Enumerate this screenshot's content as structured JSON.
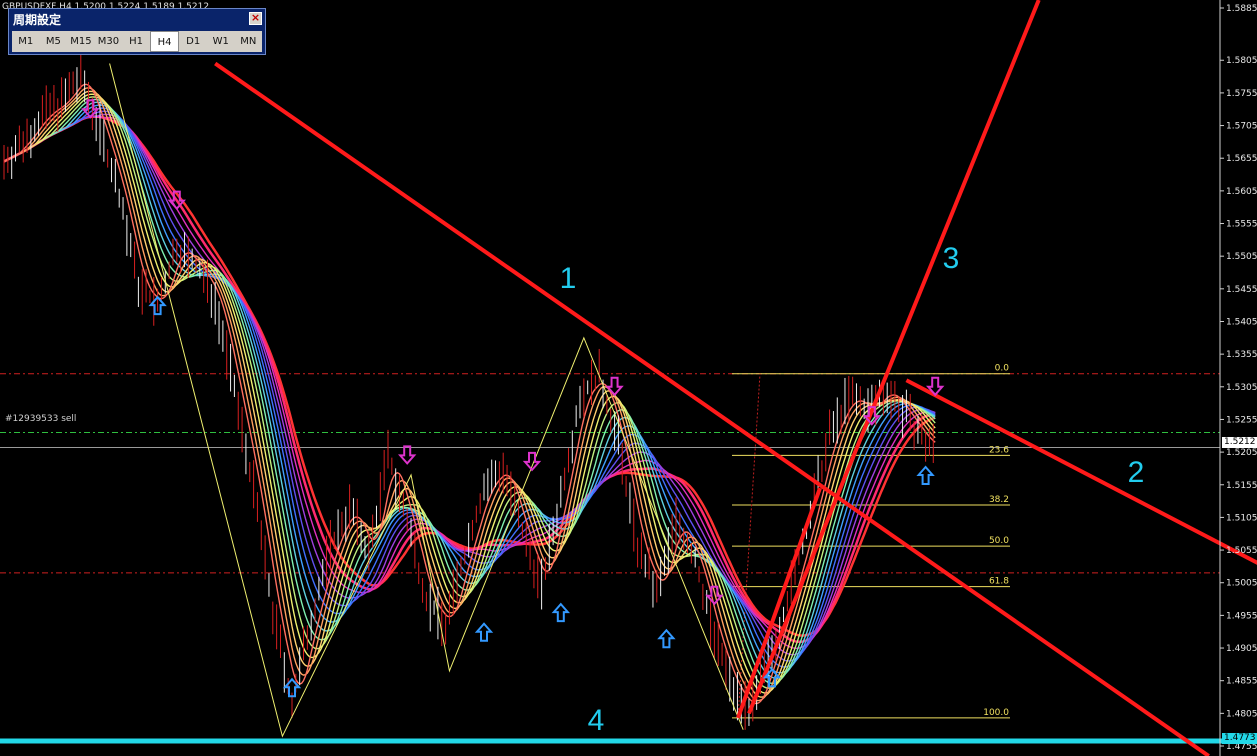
{
  "header": {
    "symbol_line": "GBPUSDFXF,H4  1.5200 1.5224 1.5189 1.5212"
  },
  "timeframe_panel": {
    "title": "周期設定",
    "buttons": [
      "M1",
      "M5",
      "M15",
      "M30",
      "H1",
      "H4",
      "D1",
      "W1",
      "MN"
    ],
    "active": "H4"
  },
  "order_label": "#12939533 sell",
  "wave_labels": [
    "1",
    "2",
    "3",
    "4"
  ],
  "colors": {
    "background": "#000000",
    "trendline": "#ff1a1a",
    "candle": "#d92020",
    "fib": "#f0e060",
    "support": "#22d8e8",
    "buy_arrow": "#3399ff",
    "sell_arrow": "#dd33cc"
  },
  "chart_data": {
    "type": "line",
    "title": "GBPUSDFXF,H4",
    "y_axis": {
      "range": [
        1.4755,
        1.5885
      ],
      "tick_labels": [
        "1.5885",
        "1.5805",
        "1.5755",
        "1.5705",
        "1.5655",
        "1.5605",
        "1.5555",
        "1.5505",
        "1.5455",
        "1.5405",
        "1.5355",
        "1.5305",
        "1.5255",
        "1.5205",
        "1.5155",
        "1.5105",
        "1.5055",
        "1.5005",
        "1.4955",
        "1.4905",
        "1.4855",
        "1.4805",
        "1.4755"
      ]
    },
    "current_price": "1.5212",
    "support_price": "1.4773",
    "order_price": 1.5235,
    "fibonacci": {
      "high": 1.5325,
      "low": 1.4798,
      "levels": [
        {
          "label": "0.0",
          "value": 1.5325
        },
        {
          "label": "23.6",
          "value": 1.52
        },
        {
          "label": "38.2",
          "value": 1.5124
        },
        {
          "label": "50.0",
          "value": 1.5061
        },
        {
          "label": "61.8",
          "value": 1.4999
        },
        {
          "label": "100.0",
          "value": 1.4798
        }
      ]
    },
    "horizontal_levels": [
      {
        "name": "resistance",
        "value": 1.5325
      },
      {
        "name": "order",
        "value": 1.5235
      },
      {
        "name": "support-dash",
        "value": 1.502
      }
    ],
    "price_path": [
      {
        "bar": 0,
        "price": 1.565
      },
      {
        "bar": 10,
        "price": 1.568
      },
      {
        "bar": 20,
        "price": 1.572
      },
      {
        "bar": 30,
        "price": 1.574
      },
      {
        "bar": 40,
        "price": 1.578
      },
      {
        "bar": 50,
        "price": 1.57
      },
      {
        "bar": 60,
        "price": 1.56
      },
      {
        "bar": 70,
        "price": 1.546
      },
      {
        "bar": 80,
        "price": 1.543
      },
      {
        "bar": 90,
        "price": 1.552
      },
      {
        "bar": 100,
        "price": 1.549
      },
      {
        "bar": 110,
        "price": 1.544
      },
      {
        "bar": 120,
        "price": 1.53
      },
      {
        "bar": 130,
        "price": 1.515
      },
      {
        "bar": 140,
        "price": 1.496
      },
      {
        "bar": 150,
        "price": 1.482
      },
      {
        "bar": 160,
        "price": 1.495
      },
      {
        "bar": 170,
        "price": 1.506
      },
      {
        "bar": 180,
        "price": 1.512
      },
      {
        "bar": 190,
        "price": 1.505
      },
      {
        "bar": 200,
        "price": 1.52
      },
      {
        "bar": 210,
        "price": 1.51
      },
      {
        "bar": 220,
        "price": 1.498
      },
      {
        "bar": 230,
        "price": 1.494
      },
      {
        "bar": 240,
        "price": 1.505
      },
      {
        "bar": 250,
        "price": 1.515
      },
      {
        "bar": 260,
        "price": 1.518
      },
      {
        "bar": 270,
        "price": 1.508
      },
      {
        "bar": 280,
        "price": 1.5
      },
      {
        "bar": 290,
        "price": 1.514
      },
      {
        "bar": 300,
        "price": 1.529
      },
      {
        "bar": 310,
        "price": 1.532
      },
      {
        "bar": 320,
        "price": 1.522
      },
      {
        "bar": 330,
        "price": 1.506
      },
      {
        "bar": 340,
        "price": 1.499
      },
      {
        "bar": 350,
        "price": 1.51
      },
      {
        "bar": 360,
        "price": 1.504
      },
      {
        "bar": 370,
        "price": 1.492
      },
      {
        "bar": 380,
        "price": 1.484
      },
      {
        "bar": 390,
        "price": 1.481
      },
      {
        "bar": 400,
        "price": 1.49
      },
      {
        "bar": 410,
        "price": 1.5
      },
      {
        "bar": 420,
        "price": 1.511
      },
      {
        "bar": 430,
        "price": 1.523
      },
      {
        "bar": 440,
        "price": 1.529
      },
      {
        "bar": 450,
        "price": 1.527
      },
      {
        "bar": 460,
        "price": 1.53
      },
      {
        "bar": 470,
        "price": 1.526
      },
      {
        "bar": 480,
        "price": 1.522
      },
      {
        "bar": 485,
        "price": 1.5212
      }
    ],
    "sell_arrows": [
      {
        "bar": 45,
        "price": 1.573
      },
      {
        "bar": 90,
        "price": 1.559
      },
      {
        "bar": 210,
        "price": 1.52
      },
      {
        "bar": 275,
        "price": 1.519
      },
      {
        "bar": 318,
        "price": 1.5305
      },
      {
        "bar": 370,
        "price": 1.4985
      },
      {
        "bar": 452,
        "price": 1.526
      },
      {
        "bar": 485,
        "price": 1.5305
      }
    ],
    "buy_arrows": [
      {
        "bar": 80,
        "price": 1.543
      },
      {
        "bar": 150,
        "price": 1.4845
      },
      {
        "bar": 250,
        "price": 1.493
      },
      {
        "bar": 290,
        "price": 1.496
      },
      {
        "bar": 345,
        "price": 1.492
      },
      {
        "bar": 400,
        "price": 1.486
      },
      {
        "bar": 480,
        "price": 1.517
      }
    ],
    "zigzag": [
      {
        "bar": 55,
        "price": 1.58
      },
      {
        "bar": 145,
        "price": 1.477
      },
      {
        "bar": 212,
        "price": 1.517
      },
      {
        "bar": 232,
        "price": 1.487
      },
      {
        "bar": 302,
        "price": 1.538
      },
      {
        "bar": 385,
        "price": 1.478
      }
    ],
    "trendlines": [
      {
        "name": "line-1",
        "from": {
          "bar": 110,
          "price": 1.58
        },
        "to": {
          "bar": 620,
          "price": 1.4755
        }
      },
      {
        "name": "line-2",
        "from": {
          "bar": 470,
          "price": 1.5315
        },
        "to": {
          "bar": 640,
          "price": 1.5055
        }
      },
      {
        "name": "line-3",
        "from": {
          "bar": 388,
          "price": 1.4805
        },
        "to": {
          "bar": 540,
          "price": 1.5905
        }
      }
    ],
    "ribbon_count": 14
  }
}
